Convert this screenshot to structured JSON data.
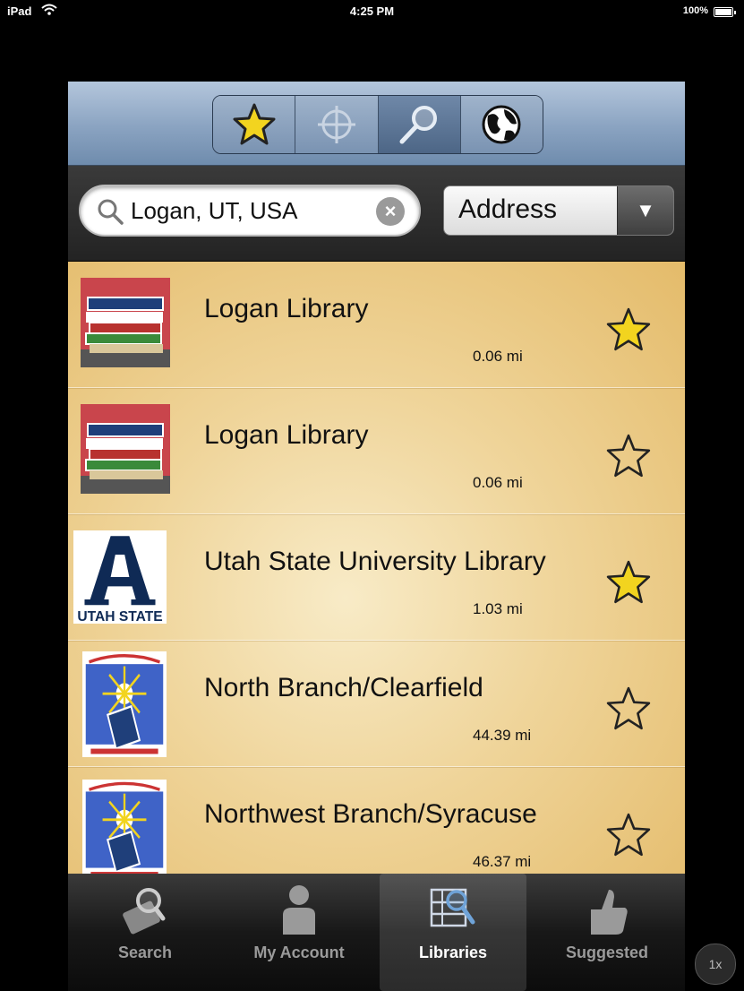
{
  "status_bar": {
    "device": "iPad",
    "time": "4:25 PM",
    "battery": "100%"
  },
  "toolbar": {
    "segments": [
      {
        "name": "favorites",
        "icon": "star-icon"
      },
      {
        "name": "nearby",
        "icon": "crosshair-icon"
      },
      {
        "name": "search",
        "icon": "magnifier-icon"
      },
      {
        "name": "world",
        "icon": "globe-icon"
      }
    ],
    "active_segment": "search"
  },
  "search": {
    "value": "Logan, UT, USA",
    "type_selected": "Address"
  },
  "libraries": [
    {
      "name": "Logan Library",
      "distance": "0.06 mi",
      "favorite": true,
      "logo": "books"
    },
    {
      "name": "Logan Library",
      "distance": "0.06 mi",
      "favorite": false,
      "logo": "books"
    },
    {
      "name": "Utah State University Library",
      "distance": "1.03 mi",
      "favorite": true,
      "logo": "usu",
      "logo_text": "UTAH STATE"
    },
    {
      "name": "North Branch/Clearfield",
      "distance": "44.39 mi",
      "favorite": false,
      "logo": "davis"
    },
    {
      "name": "Northwest Branch/Syracuse",
      "distance": "46.37 mi",
      "favorite": false,
      "logo": "davis"
    }
  ],
  "tabs": [
    {
      "label": "Search",
      "icon": "search-tab-icon"
    },
    {
      "label": "My Account",
      "icon": "account-icon"
    },
    {
      "label": "Libraries",
      "icon": "libraries-icon"
    },
    {
      "label": "Suggested",
      "icon": "thumbs-up-icon"
    }
  ],
  "active_tab": "Libraries",
  "zoom": "1x",
  "colors": {
    "star_gold": "#f2d41f",
    "toolbar_blue": "#8aa3c1",
    "list_gold": "#efd499"
  }
}
